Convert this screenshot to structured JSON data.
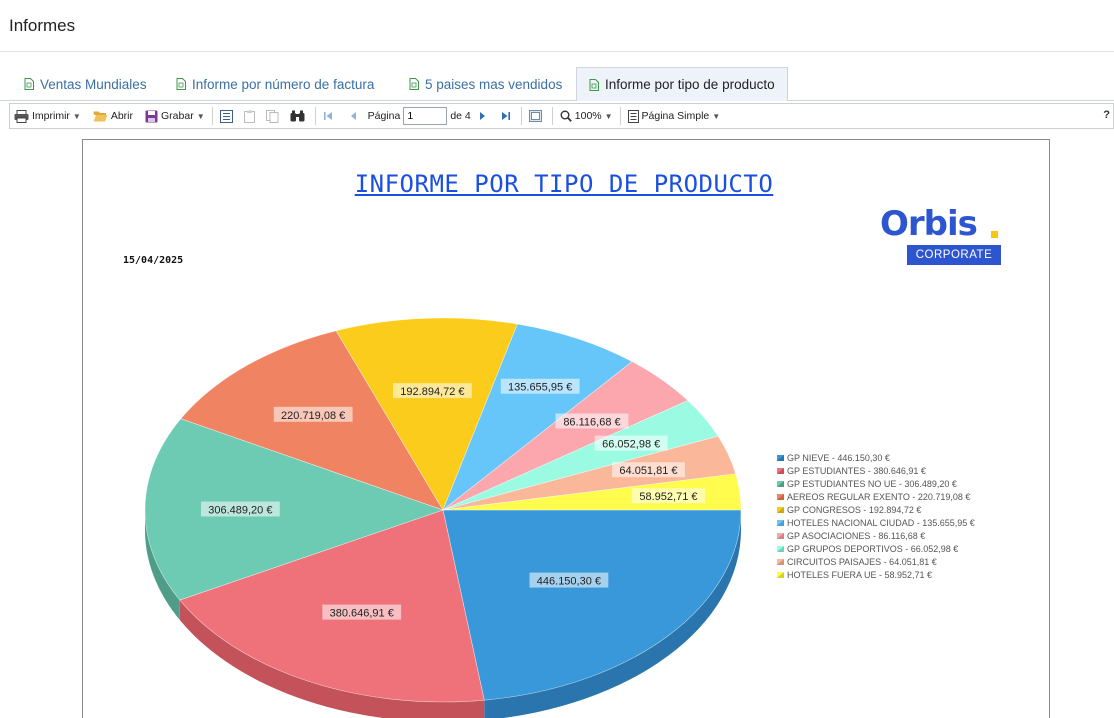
{
  "header": {
    "title": "Informes"
  },
  "tabs": [
    {
      "label": "Ventas Mundiales",
      "active": false
    },
    {
      "label": "Informe por número de factura",
      "active": false
    },
    {
      "label": "5 paises mas vendidos",
      "active": false
    },
    {
      "label": "Informe por tipo de producto",
      "active": true
    }
  ],
  "toolbar": {
    "print_label": "Imprimir",
    "open_label": "Abrir",
    "save_label": "Grabar",
    "page_label": "Página",
    "page_value": "1",
    "page_of": "de 4",
    "zoom_label": "100%",
    "view_label": "Página Simple",
    "help_label": "?"
  },
  "report": {
    "title": "INFORME POR TIPO DE PRODUCTO",
    "date": "15/04/2025",
    "logo_word": "Orbis",
    "logo_badge": "CORPORATE"
  },
  "colors": {
    "accent": "#2c55cf",
    "title_blue": "#1a4fe0",
    "logo_dot": "#f7c613"
  },
  "chart_data": {
    "type": "pie",
    "currency": "€",
    "slices": [
      {
        "label": "GP NIEVE",
        "value_text": "446.150,30 €",
        "legend_text": "GP NIEVE - 446.150,30 €",
        "value": 446150.3,
        "color": "#3898d9",
        "dark": "#2a75ad"
      },
      {
        "label": "GP ESTUDIANTES",
        "value_text": "380.646,91 €",
        "legend_text": "GP ESTUDIANTES - 380.646,91 €",
        "value": 380646.91,
        "color": "#ef727b",
        "dark": "#c4525a"
      },
      {
        "label": "GP ESTUDIANTES NO UE",
        "value_text": "306.489,20 €",
        "legend_text": "GP ESTUDIANTES NO UE - 306.489,20 €",
        "value": 306489.2,
        "color": "#6dcab3",
        "dark": "#4f9d89"
      },
      {
        "label": "AEREOS REGULAR EXENTO",
        "value_text": "220.719,08 €",
        "legend_text": "AEREOS REGULAR EXENTO - 220.719,08 €",
        "value": 220719.08,
        "color": "#f08462",
        "dark": "#c56648"
      },
      {
        "label": "GP CONGRESOS",
        "value_text": "192.894,72 €",
        "legend_text": "GP CONGRESOS - 192.894,72 €",
        "value": 192894.72,
        "color": "#fbcc1b",
        "dark": "#d1a812"
      },
      {
        "label": "HOTELES NACIONAL CIUDAD",
        "value_text": "135.655,95 €",
        "legend_text": "HOTELES NACIONAL CIUDAD - 135.655,95 €",
        "value": 135655.95,
        "color": "#66c6fa",
        "dark": "#4a9fcf"
      },
      {
        "label": "GP ASOCIACIONES",
        "value_text": "86.116,68 €",
        "legend_text": "GP ASOCIACIONES - 86.116,68 €",
        "value": 86116.68,
        "color": "#fba7ad",
        "dark": "#d0848a"
      },
      {
        "label": "GP GRUPOS DEPORTIVOS",
        "value_text": "66.052,98 €",
        "legend_text": "GP GRUPOS DEPORTIVOS - 66.052,98 €",
        "value": 66052.98,
        "color": "#9bfbe2",
        "dark": "#74d1b9"
      },
      {
        "label": "CIRCUITOS PAISAJES",
        "value_text": "64.051,81 €",
        "legend_text": "CIRCUITOS PAISAJES - 64.051,81 €",
        "value": 64051.81,
        "color": "#fbb799",
        "dark": "#d39579"
      },
      {
        "label": "HOTELES FUERA UE",
        "value_text": "58.952,71 €",
        "legend_text": "HOTELES FUERA UE - 58.952,71 €",
        "value": 58952.71,
        "color": "#fffc4d",
        "dark": "#d4d12f"
      }
    ],
    "legend_position": "right"
  }
}
